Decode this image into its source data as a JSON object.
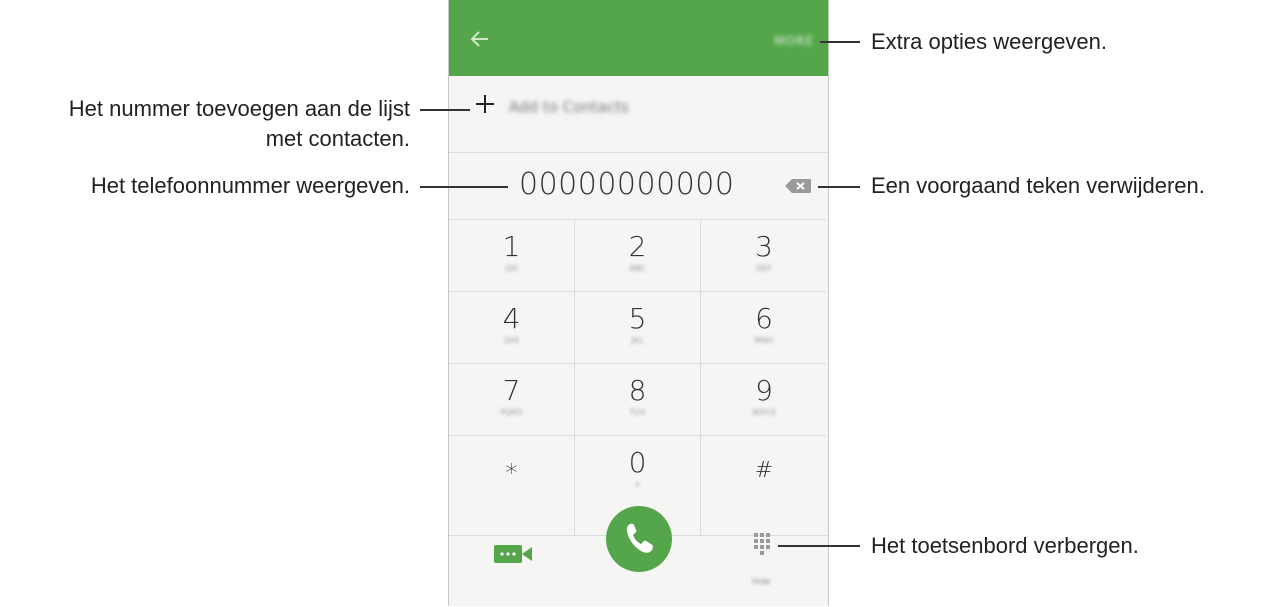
{
  "appbar": {
    "more_label": "MORE"
  },
  "add_contacts": {
    "label": "Add to Contacts"
  },
  "phone_number": "00000000000",
  "keypad": [
    {
      "digit": "1",
      "sub": "QO"
    },
    {
      "digit": "2",
      "sub": "ABC"
    },
    {
      "digit": "3",
      "sub": "DEF"
    },
    {
      "digit": "4",
      "sub": "GHI"
    },
    {
      "digit": "5",
      "sub": "JKL"
    },
    {
      "digit": "6",
      "sub": "MNO"
    },
    {
      "digit": "7",
      "sub": "PQRS"
    },
    {
      "digit": "8",
      "sub": "TUV"
    },
    {
      "digit": "9",
      "sub": "WXYZ"
    },
    {
      "digit": "*",
      "sub": ""
    },
    {
      "digit": "0",
      "sub": "+"
    },
    {
      "digit": "#",
      "sub": ""
    }
  ],
  "bottom": {
    "hide_label": "Hide"
  },
  "callouts": {
    "more_options": "Extra opties weergeven.",
    "add_contact_line1": "Het nummer toevoegen aan de lijst",
    "add_contact_line2": "met contacten.",
    "show_number": "Het telefoonnummer weergeven.",
    "delete_char": "Een voorgaand teken verwijderen.",
    "hide_keypad": "Het toetsenbord verbergen."
  },
  "colors": {
    "accent": "#55a64b",
    "background": "#f5f5f3"
  }
}
